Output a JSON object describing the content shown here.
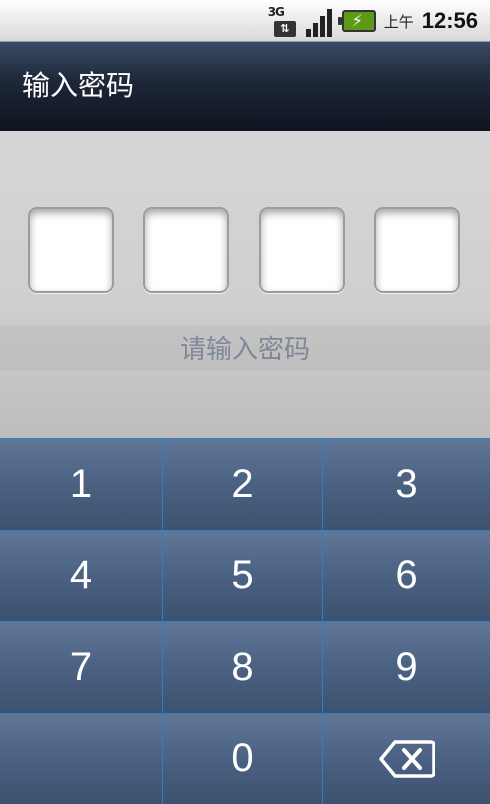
{
  "status_bar": {
    "network_type": "3G",
    "network_arrows": "⇅",
    "am_pm": "上午",
    "time": "12:56",
    "icons": [
      "network-3g-icon",
      "signal-icon",
      "battery-charging-icon"
    ]
  },
  "title_bar": {
    "title": "输入密码"
  },
  "password": {
    "slots": 4,
    "hint": "请输入密码"
  },
  "keypad": {
    "keys": [
      "1",
      "2",
      "3",
      "4",
      "5",
      "6",
      "7",
      "8",
      "9",
      "",
      "0",
      "backspace-icon"
    ]
  },
  "colors": {
    "title_bar": "#1d2738",
    "key_bg": "#4d6383",
    "key_divider": "#2f7fc2",
    "hint_text": "#7e8896",
    "battery": "#5c9a17"
  }
}
